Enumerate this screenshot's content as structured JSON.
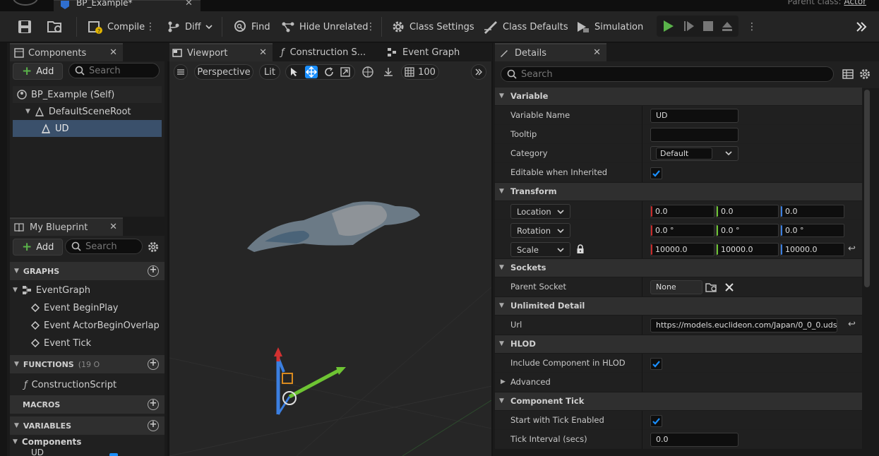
{
  "title_bar": {
    "document_tab": "BP_Example*",
    "parent_class_label": "Parent class:",
    "parent_class_value": "Actor"
  },
  "toolbar": {
    "compile": "Compile",
    "diff": "Diff",
    "find": "Find",
    "hide_unrelated": "Hide Unrelated",
    "class_settings": "Class Settings",
    "class_defaults": "Class Defaults",
    "simulation": "Simulation"
  },
  "components_panel": {
    "tab": "Components",
    "add": "Add",
    "search_placeholder": "Search",
    "tree": [
      "BP_Example (Self)",
      "DefaultSceneRoot",
      "UD"
    ]
  },
  "my_blueprint_panel": {
    "tab": "My Blueprint",
    "add": "Add",
    "search_placeholder": "Search",
    "graphs_header": "GRAPHS",
    "event_graph": "EventGraph",
    "events": [
      "Event BeginPlay",
      "Event ActorBeginOverlap",
      "Event Tick"
    ],
    "functions_header": "FUNCTIONS",
    "functions_count": "(19 O",
    "construction_script": "ConstructionScript",
    "macros_header": "MACROS",
    "variables_header": "VARIABLES",
    "components_group": "Components",
    "ud_item": "UD"
  },
  "center_tabs": {
    "viewport": "Viewport",
    "construction": "Construction S...",
    "event_graph": "Event Graph"
  },
  "viewport_toolbar": {
    "perspective": "Perspective",
    "lit": "Lit",
    "grid_size": "100"
  },
  "details_panel": {
    "tab": "Details",
    "search_placeholder": "Search",
    "variable_section": "Variable",
    "variable_name_label": "Variable Name",
    "variable_name_value": "UD",
    "tooltip_label": "Tooltip",
    "tooltip_value": "",
    "category_label": "Category",
    "category_value": "Default",
    "editable_label": "Editable when Inherited",
    "transform_section": "Transform",
    "location_label": "Location",
    "location": [
      "0.0",
      "0.0",
      "0.0"
    ],
    "rotation_label": "Rotation",
    "rotation": [
      "0.0 °",
      "0.0 °",
      "0.0 °"
    ],
    "scale_label": "Scale",
    "scale": [
      "10000.0",
      "10000.0",
      "10000.0"
    ],
    "sockets_section": "Sockets",
    "parent_socket_label": "Parent Socket",
    "parent_socket_value": "None",
    "unlimited_detail_section": "Unlimited Detail",
    "url_label": "Url",
    "url_value": "https://models.euclideon.com/Japan/0_0_0.uds",
    "hlod_section": "HLOD",
    "include_hlod_label": "Include Component in HLOD",
    "advanced_label": "Advanced",
    "component_tick_section": "Component Tick",
    "start_tick_label": "Start with Tick Enabled",
    "tick_interval_label": "Tick Interval (secs)",
    "tick_interval_value": "0.0"
  },
  "colors": {
    "accent_blue": "#2f5a88",
    "selection": "#3a506b",
    "play_green": "#5ab34a",
    "checkbox_blue": "#1a8fff"
  }
}
